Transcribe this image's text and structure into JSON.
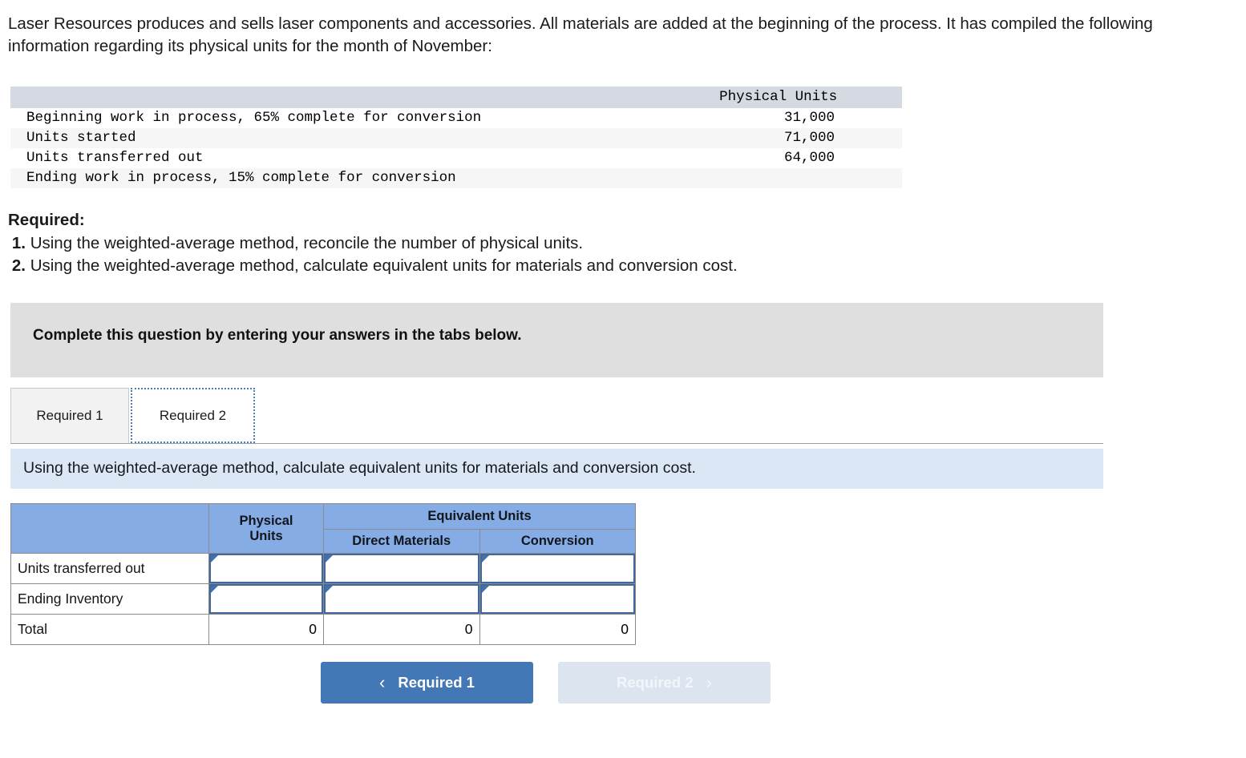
{
  "intro": {
    "paragraph": "Laser Resources produces and sells laser components and accessories. All materials are added at the beginning of the process. It has compiled the following information regarding its physical units for the month of November:"
  },
  "facts_table": {
    "header_blank": "",
    "header_units": "Physical Units",
    "rows": [
      {
        "label": "Beginning work in process, 65% complete for conversion",
        "value": "31,000"
      },
      {
        "label": "Units started",
        "value": "71,000"
      },
      {
        "label": "Units transferred out",
        "value": "64,000"
      },
      {
        "label": "Ending work in process, 15% complete for conversion",
        "value": ""
      }
    ]
  },
  "required": {
    "title": "Required:",
    "items": [
      {
        "num": "1.",
        "text": "Using the weighted-average method, reconcile the number of physical units."
      },
      {
        "num": "2.",
        "text": "Using the weighted-average method, calculate equivalent units for materials and conversion cost."
      }
    ]
  },
  "gray_panel": {
    "text": "Complete this question by entering your answers in the tabs below."
  },
  "tabs": [
    {
      "label": "Required 1",
      "active": false
    },
    {
      "label": "Required 2",
      "active": true
    }
  ],
  "instruction": {
    "text": "Using the weighted-average method, calculate equivalent units for materials and conversion cost."
  },
  "answer_table": {
    "headers": {
      "blank": "",
      "physical_units": "Physical\nUnits",
      "physical_units_line1": "Physical",
      "physical_units_line2": "Units",
      "equivalent_units": "Equivalent Units",
      "direct_materials": "Direct Materials",
      "conversion": "Conversion"
    },
    "rows": [
      {
        "label": "Units transferred out",
        "physical_units": "",
        "direct_materials": "",
        "conversion": "",
        "editable": true
      },
      {
        "label": "Ending Inventory",
        "physical_units": "",
        "direct_materials": "",
        "conversion": "",
        "editable": true
      },
      {
        "label": "Total",
        "physical_units": "0",
        "direct_materials": "0",
        "conversion": "0",
        "editable": false
      }
    ]
  },
  "nav": {
    "prev_label": "Required 1",
    "prev_chevron": "‹",
    "next_label": "Required 2",
    "next_chevron": "›"
  },
  "colors": {
    "header_blue": "#85ace4",
    "instruction_blue": "#dce7f5",
    "gray_panel": "#dfdfdf",
    "facts_header": "#d5d9e2",
    "active_button": "#4477b5",
    "disabled_button": "#dbe4ef",
    "input_border": "#41689e",
    "tab_focus": "#4a7ebb"
  }
}
